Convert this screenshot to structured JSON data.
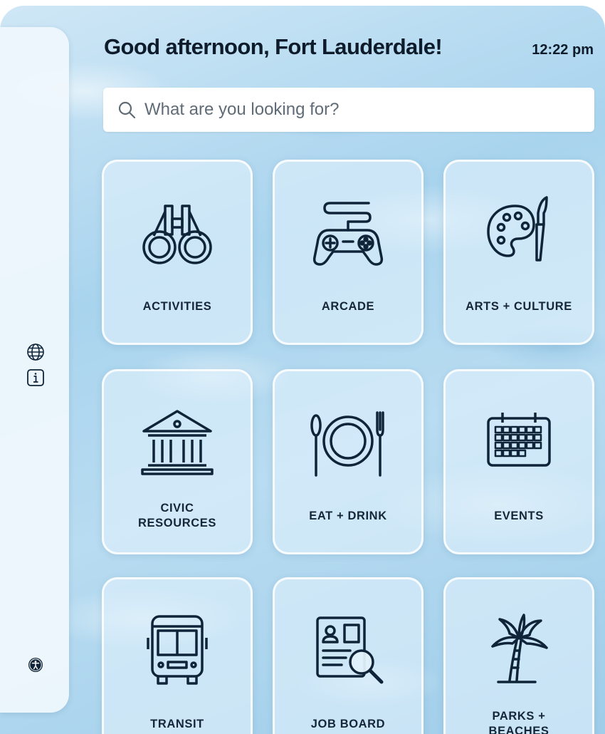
{
  "header": {
    "greeting": "Good afternoon, Fort Lauderdale!",
    "time": "12:22 pm"
  },
  "search": {
    "placeholder": "What are you looking for?",
    "value": ""
  },
  "sidebar": {
    "icons": [
      "globe-icon",
      "info-icon",
      "accessibility-icon"
    ]
  },
  "tiles": [
    {
      "label": "ACTIVITIES",
      "icon": "binoculars-icon"
    },
    {
      "label": "ARCADE",
      "icon": "gamepad-icon"
    },
    {
      "label": "ARTS + CULTURE",
      "icon": "palette-icon"
    },
    {
      "label": "CIVIC\nRESOURCES",
      "icon": "government-building-icon"
    },
    {
      "label": "EAT + DRINK",
      "icon": "plate-cutlery-icon"
    },
    {
      "label": "EVENTS",
      "icon": "calendar-icon"
    },
    {
      "label": "TRANSIT",
      "icon": "bus-icon"
    },
    {
      "label": "JOB BOARD",
      "icon": "resume-search-icon"
    },
    {
      "label": "PARKS +\nBEACHES",
      "icon": "palm-tree-icon"
    }
  ],
  "colors": {
    "icon_stroke": "#0f2438",
    "text": "#0d1b2a",
    "water": "#a9d4ee"
  }
}
